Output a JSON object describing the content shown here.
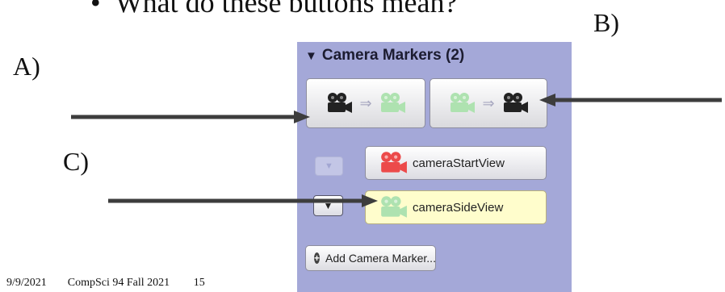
{
  "slide": {
    "bullet": "What do these buttons mean?",
    "label_a": "A)",
    "label_b": "B)",
    "label_c": "C)",
    "footer_date": "9/9/2021",
    "footer_course": "CompSci 94 Fall 2021",
    "footer_page": "15"
  },
  "panel": {
    "header": "Camera Markers (2)",
    "header_icon": "triangle-down-icon",
    "buttons": [
      {
        "name": "camera-to-marker",
        "icons": [
          "camera-icon-dark",
          "arrow-icon",
          "camera-icon-green"
        ]
      },
      {
        "name": "marker-to-camera",
        "icons": [
          "camera-icon-green",
          "arrow-icon",
          "camera-icon-dark"
        ]
      }
    ],
    "markers": [
      {
        "label": "cameraStartView",
        "icon_color": "#ec4a4a",
        "selected": false
      },
      {
        "label": "cameraSideView",
        "icon_color": "#aee2b0",
        "selected": true
      }
    ],
    "add_button": "Add Camera Marker..."
  },
  "colors": {
    "panel_bg": "#a4a8d8",
    "selected_bg": "#fffdcc",
    "arrow": "#3d3d3d"
  }
}
